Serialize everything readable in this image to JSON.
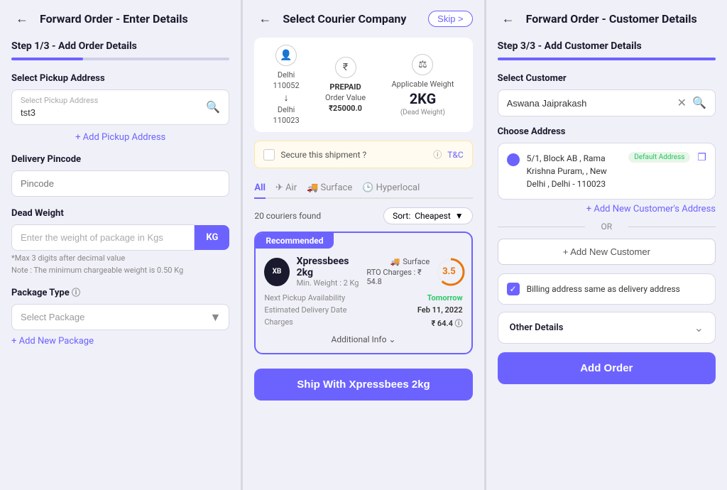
{
  "panel1": {
    "header": "Forward Order - Enter Details",
    "step_label": "Step 1/3 - Add Order Details",
    "progress_width": "33%",
    "sections": {
      "pickup": {
        "label": "Select Pickup Address",
        "placeholder": "Select Pickup Address",
        "sub_value": "tst3",
        "add_link": "+ Add Pickup Address"
      },
      "delivery": {
        "label": "Delivery Pincode",
        "placeholder": "Pincode"
      },
      "dead_weight": {
        "label": "Dead Weight",
        "placeholder": "Enter the weight of package in Kgs",
        "unit": "KG",
        "note1": "*Max 3 digits after decimal value",
        "note2": "Note : The minimum chargeable weight is 0.50 Kg"
      },
      "package": {
        "label": "Package Type",
        "placeholder": "Select Package",
        "add_link": "+ Add New Package"
      }
    }
  },
  "panel2": {
    "header": "Select Courier Company",
    "skip_label": "Skip >",
    "info_bar": {
      "from_city": "Delhi",
      "from_pin": "110052",
      "to_city": "Delhi",
      "to_pin": "110023",
      "payment": "PREPAID",
      "order_value_label": "Order Value",
      "order_value": "₹25000.0",
      "weight_label": "Applicable Weight",
      "weight_value": "2KG",
      "weight_sub": "(Dead Weight)"
    },
    "secure": {
      "text": "Secure this shipment ?",
      "tnc": "T&C"
    },
    "tabs": [
      "All",
      "Air",
      "Surface",
      "Hyperlocal"
    ],
    "active_tab": "All",
    "couriers_found": "20 couriers found",
    "sort_label": "Sort:",
    "sort_value": "Cheapest",
    "recommended_card": {
      "badge": "Recommended",
      "name": "Xpressbees 2kg",
      "min_weight": "Min. Weight : 2 Kg",
      "mode": "Surface",
      "rto": "RTO Charges : ₹ 54.8",
      "rating": "3.5",
      "pickup_label": "Next Pickup Availability",
      "pickup_value": "Tomorrow",
      "delivery_label": "Estimated Delivery Date",
      "delivery_value": "Feb 11, 2022",
      "charges_label": "Charges",
      "charges_value": "₹ 64.4",
      "additional_info": "Additional Info"
    },
    "ship_btn": "Ship With Xpressbees 2kg"
  },
  "panel3": {
    "header": "Forward Order - Customer Details",
    "step_label": "Step 3/3 - Add Customer Details",
    "progress_width": "100%",
    "sections": {
      "customer": {
        "label": "Select Customer",
        "value": "Aswana Jaiprakash",
        "choose_address_label": "Choose Address",
        "address": "5/1, Block AB , Rama Krishna Puram, , New Delhi , Delhi - 110023",
        "default_badge": "Default Address",
        "add_address_link": "+ Add New Customer's Address"
      },
      "or": "OR",
      "add_new_customer": "+ Add New Customer",
      "billing": {
        "label": "Billing address same as delivery address"
      },
      "other_details": "Other Details",
      "add_order_btn": "Add Order"
    }
  }
}
